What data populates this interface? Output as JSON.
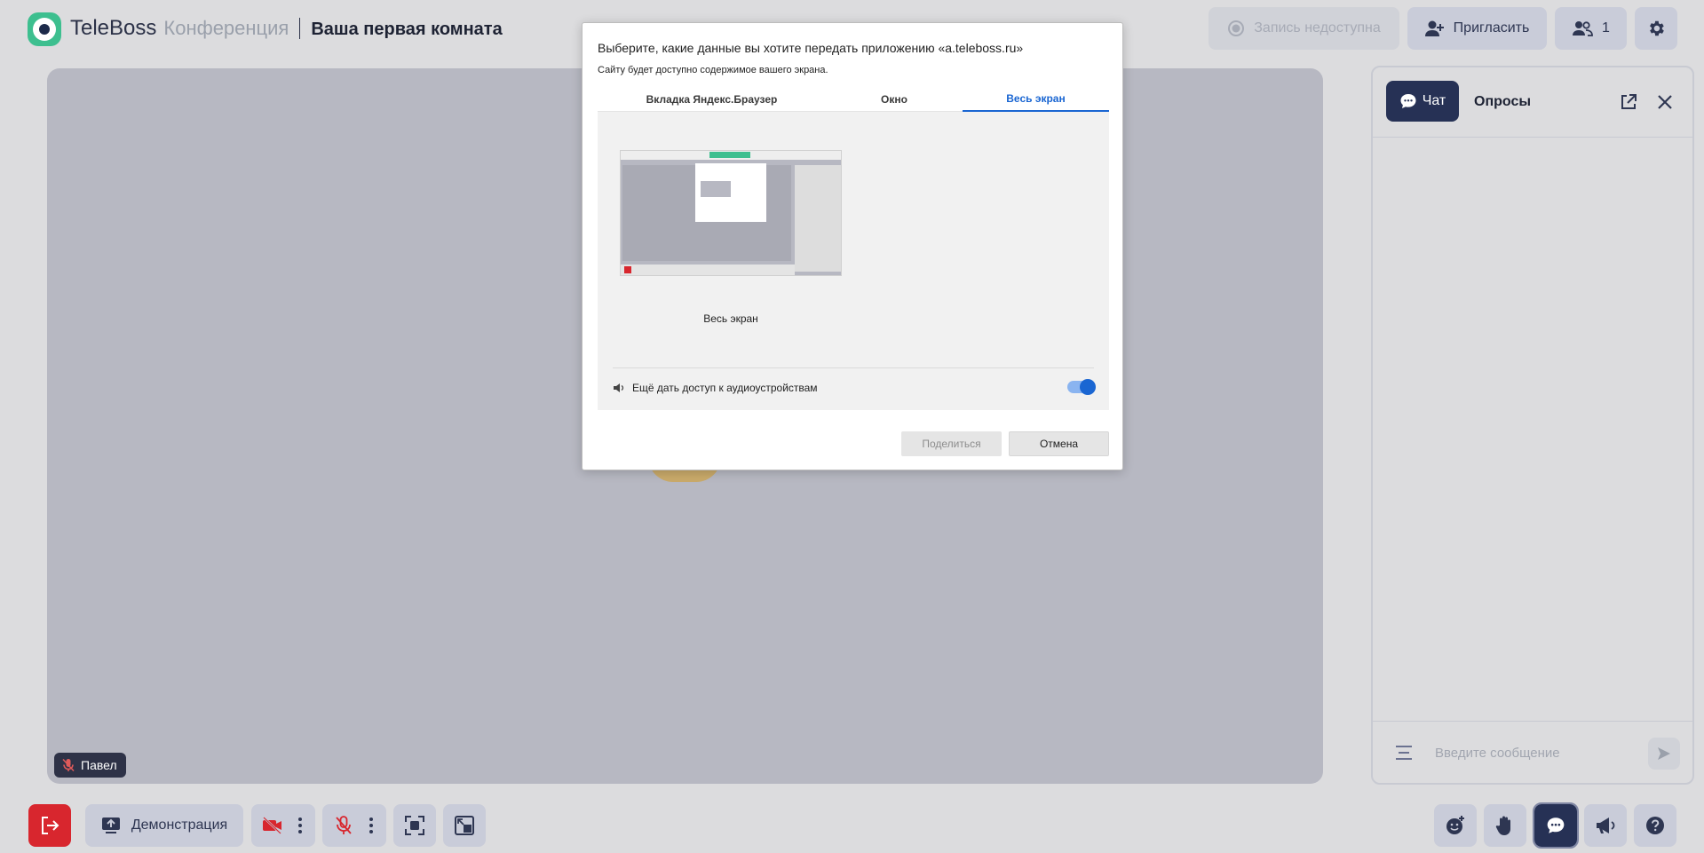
{
  "header": {
    "brand": "TeleBoss",
    "product": "Конференция",
    "room_title": "Ваша первая комната",
    "record_label": "Запись недоступна",
    "invite_label": "Пригласить",
    "participants_count": "1"
  },
  "stage": {
    "participant_name": "Павел"
  },
  "chat": {
    "tab_chat": "Чат",
    "tab_polls": "Опросы",
    "input_placeholder": "Введите сообщение"
  },
  "toolbar": {
    "demo_label": "Демонстрация"
  },
  "dialog": {
    "title": "Выберите, какие данные вы хотите передать приложению «a.teleboss.ru»",
    "subtitle": "Сайту будет доступно содержимое вашего экрана.",
    "tabs": [
      "Вкладка Яндекс.Браузер",
      "Окно",
      "Весь экран"
    ],
    "active_tab": "Весь экран",
    "thumbnail_caption": "Весь экран",
    "audio_label": "Ещё дать доступ к аудиоустройствам",
    "audio_enabled": true,
    "share_label": "Поделиться",
    "cancel_label": "Отмена"
  },
  "colors": {
    "accent": "#263155",
    "brand_green": "#3dbf8f",
    "danger": "#d8262e",
    "dialog_accent": "#1a66d2"
  }
}
